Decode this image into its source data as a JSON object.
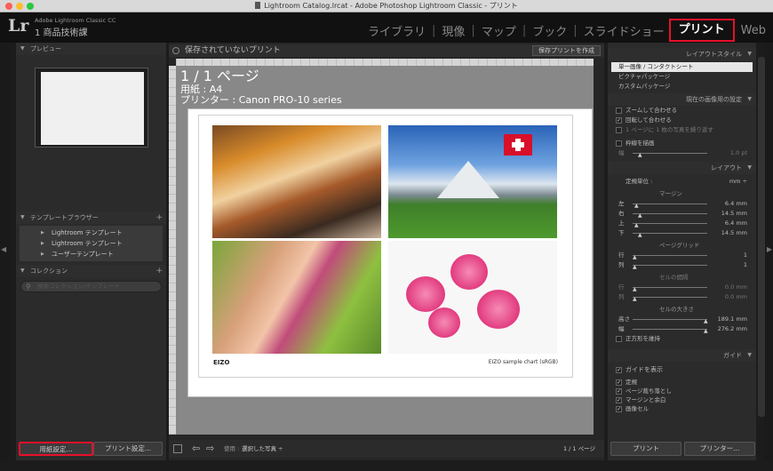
{
  "window": {
    "title": "Lightroom Catalog.lrcat - Adobe Photoshop Lightroom Classic - プリント"
  },
  "identity": {
    "logo": "Lr",
    "app_name": "Adobe Lightroom Classic CC",
    "catalog": "1 商品技術課"
  },
  "modules": [
    {
      "label": "ライブラリ"
    },
    {
      "label": "現像"
    },
    {
      "label": "マップ"
    },
    {
      "label": "ブック"
    },
    {
      "label": "スライドショー"
    },
    {
      "label": "プリント"
    },
    {
      "label": "Web"
    }
  ],
  "left_panel": {
    "preview": {
      "header": "プレビュー"
    },
    "template_browser": {
      "header": "テンプレートブラウザー",
      "items": [
        "Lightroom テンプレート",
        "Lightroom テンプレート",
        "ユーザーテンプレート"
      ]
    },
    "collections": {
      "header": "コレクション",
      "search_placeholder": "検索コレクション/テンプレート"
    },
    "page_setup_button": "用紙設定...",
    "print_settings_button": "プリント設定..."
  },
  "center": {
    "header": "保存されていないプリント",
    "save_button": "保存プリントを作成",
    "overlay": {
      "pages": "1 / 1 ページ",
      "paper": "用紙 : A4",
      "printer": "プリンター : Canon PRO-10 series"
    },
    "logo": "EIZO",
    "caption": "EIZO sample chart (sRGB)"
  },
  "toolbar": {
    "use_label": "使用 :",
    "use_value": "選択した写真 ÷",
    "page_count": "1 / 1 ページ"
  },
  "right_panel": {
    "layout_style": {
      "header": "レイアウトスタイル",
      "items": [
        "単一画像 / コンタクトシート",
        "ピクチャパッケージ",
        "カスタムパッケージ"
      ]
    },
    "image_settings": {
      "header": "現在の画像用の設定",
      "options": [
        {
          "label": "ズームして合わせる",
          "checked": false
        },
        {
          "label": "回転して合わせる",
          "checked": true
        },
        {
          "label": "1 ページに 1 枚の写真を繰り返す",
          "checked": false
        }
      ],
      "stroke_border": "枠線を描画",
      "width_label": "幅",
      "width_value": "1.0 pt"
    },
    "layout": {
      "header": "レイアウト",
      "ruler_units_label": "定規単位 :",
      "ruler_units_value": "mm ÷",
      "margins_title": "マージン",
      "margins": [
        {
          "label": "左",
          "value": "6.4 mm"
        },
        {
          "label": "右",
          "value": "14.5 mm"
        },
        {
          "label": "上",
          "value": "6.4 mm"
        },
        {
          "label": "下",
          "value": "14.5 mm"
        }
      ],
      "grid_title": "ページグリッド",
      "grid": [
        {
          "label": "行",
          "value": "1"
        },
        {
          "label": "列",
          "value": "1"
        }
      ],
      "spacing_title": "セルの間隔",
      "spacing": [
        {
          "label": "行",
          "value": "0.0 mm"
        },
        {
          "label": "列",
          "value": "0.0 mm"
        }
      ],
      "cell_size_title": "セルの大きさ",
      "cell_size": [
        {
          "label": "高さ",
          "value": "189.1 mm"
        },
        {
          "label": "幅",
          "value": "276.2 mm"
        }
      ],
      "keep_square": "正方形を維持"
    },
    "guides": {
      "header": "ガイド",
      "show_guides": "ガイドを表示",
      "items": [
        "定規",
        "ページ裁ち落とし",
        "マージンと余白",
        "画像セル"
      ]
    },
    "print_button": "プリント",
    "printer_button": "プリンター..."
  },
  "colors": {
    "accent_highlight": "#e8102a",
    "panel_bg": "#2b2b2b"
  }
}
